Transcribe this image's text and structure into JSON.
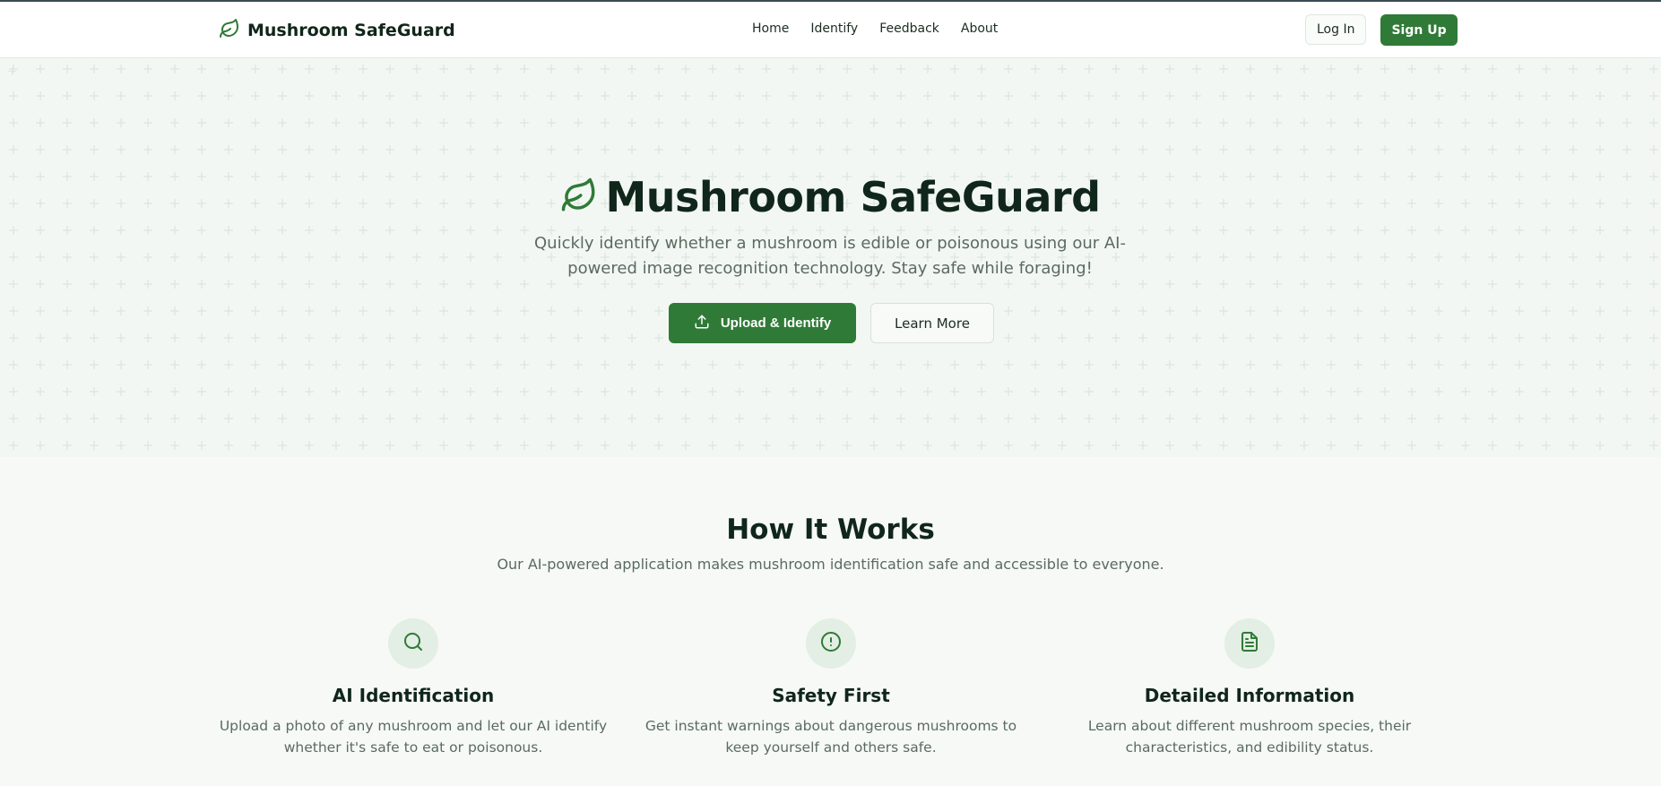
{
  "header": {
    "brand": "Mushroom SafeGuard",
    "nav": [
      "Home",
      "Identify",
      "Feedback",
      "About"
    ],
    "login_label": "Log In",
    "signup_label": "Sign Up"
  },
  "hero": {
    "title": "Mushroom SafeGuard",
    "subtitle": "Quickly identify whether a mushroom is edible or poisonous using our AI-powered image recognition technology. Stay safe while foraging!",
    "primary_label": "Upload & Identify",
    "secondary_label": "Learn More"
  },
  "how": {
    "title": "How It Works",
    "subtitle": "Our AI-powered application makes mushroom identification safe and accessible to everyone.",
    "features": [
      {
        "icon": "search-icon",
        "title": "AI Identification",
        "text": "Upload a photo of any mushroom and let our AI identify whether it's safe to eat or poisonous."
      },
      {
        "icon": "alert-circle-icon",
        "title": "Safety First",
        "text": "Get instant warnings about dangerous mushrooms to keep yourself and others safe."
      },
      {
        "icon": "file-text-icon",
        "title": "Detailed Information",
        "text": "Learn about different mushroom species, their characteristics, and edibility status."
      }
    ]
  },
  "colors": {
    "primary": "#2f7a37",
    "heading": "#10261a",
    "muted": "#5b6b60",
    "background": "#f6f9f6"
  }
}
